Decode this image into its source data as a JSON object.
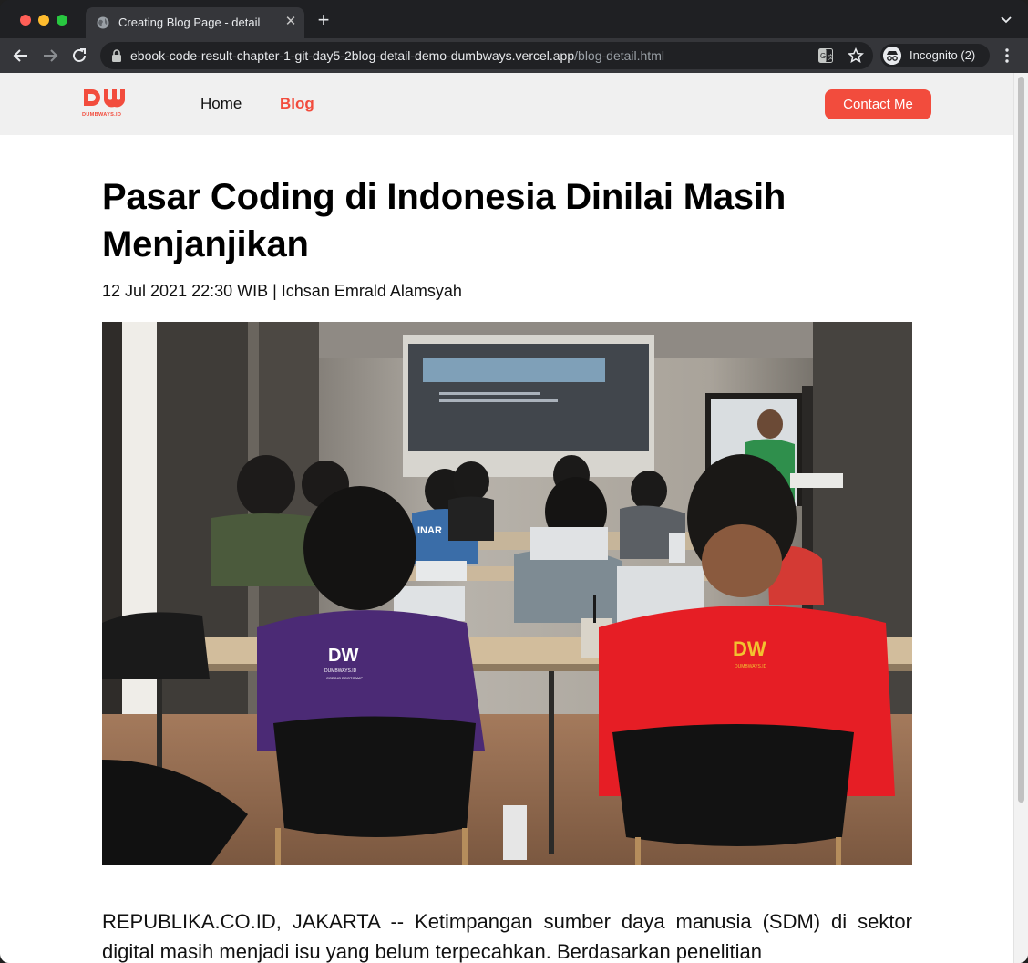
{
  "browser": {
    "tab_title": "Creating Blog Page - detail",
    "url_host": "ebook-code-result-chapter-1-git-day5-2blog-detail-demo-dumbways.vercel.app",
    "url_path": "/blog-detail.html",
    "incognito_label": "Incognito (2)"
  },
  "site": {
    "logo_text": "DUMBWAYS.ID",
    "nav": {
      "home": "Home",
      "blog": "Blog",
      "contact": "Contact Me"
    },
    "accent_color": "#f24c3d"
  },
  "article": {
    "title": "Pasar Coding di Indonesia Dinilai Masih Menjanjikan",
    "meta": "12 Jul 2021 22:30 WIB | Ichsan Emrald Alamsyah",
    "body": "REPUBLIKA.CO.ID, JAKARTA -- Ketimpangan sumber daya manusia (SDM) di sektor digital masih menjadi isu yang belum terpecahkan. Berdasarkan penelitian",
    "image": {
      "shirt_logo_text": "DUMBWAYS.ID",
      "shirt_logo_subtext": "CODING BOOTCAMP",
      "jersey_text": "INAR"
    }
  }
}
